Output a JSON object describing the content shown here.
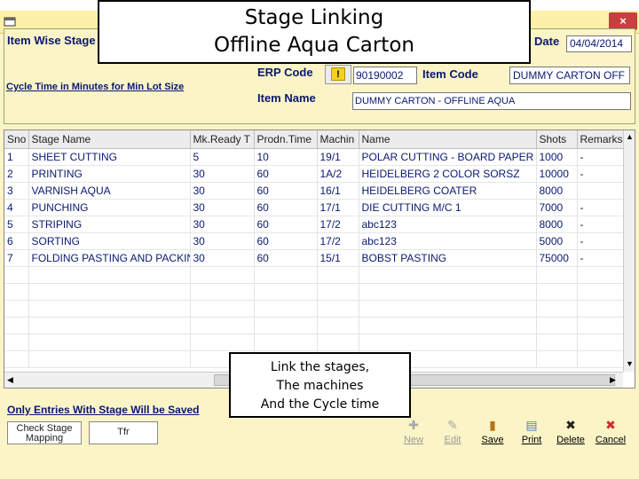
{
  "window": {
    "close_glyph": "×",
    "app_icon": "form-icon",
    "close_color": "#c73f3f"
  },
  "header": {
    "form_title": "Item Wise Stage",
    "date_label": "Date",
    "date_value": "04/04/2014",
    "cycle_time_label": "Cycle Time in Minutes for Min Lot Size",
    "erp_code_label": "ERP Code",
    "warn_glyph": "!",
    "erp_code_value": "90190002",
    "item_code_label": "Item Code",
    "item_code_value": "DUMMY CARTON   OFF",
    "item_name_label": "Item Name",
    "item_name_value": "DUMMY CARTON - OFFLINE AQUA"
  },
  "grid": {
    "columns": [
      "Sno",
      "Stage Name",
      "Mk.Ready T",
      "Prodn.Time",
      "Machin",
      "Name",
      "Shots",
      "Remarks"
    ],
    "rows": [
      [
        "1",
        "SHEET CUTTING",
        "5",
        "10",
        "19/1",
        "POLAR CUTTING - BOARD PAPER",
        "1000",
        "-"
      ],
      [
        "2",
        "PRINTING",
        "30",
        "60",
        "1A/2",
        "HEIDELBERG 2 COLOR SORSZ",
        "10000",
        "-"
      ],
      [
        "3",
        "VARNISH   AQUA",
        "30",
        "60",
        "16/1",
        "HEIDELBERG COATER",
        "8000",
        ""
      ],
      [
        "4",
        "PUNCHING",
        "30",
        "60",
        "17/1",
        "DIE CUTTING M/C 1",
        "7000",
        "-"
      ],
      [
        "5",
        "STRIPING",
        "30",
        "60",
        "17/2",
        "abc123",
        "8000",
        "-"
      ],
      [
        "6",
        "SORTING",
        "30",
        "60",
        "17/2",
        "abc123",
        "5000",
        "-"
      ],
      [
        "7",
        "FOLDING PASTING AND PACKING",
        "30",
        "60",
        "15/1",
        "BOBST PASTING",
        "75000",
        "-"
      ]
    ],
    "empty_rows": 6
  },
  "footer": {
    "note": "Only Entries With Stage Will be Saved",
    "check_button": [
      "Check Stage",
      "Mapping"
    ],
    "tfr_button": "Tfr"
  },
  "toolbar": {
    "buttons": [
      {
        "label": "New",
        "icon": "new-icon",
        "glyph": "✚",
        "enabled": false
      },
      {
        "label": "Edit",
        "icon": "edit-icon",
        "glyph": "✎",
        "enabled": false
      },
      {
        "label": "Save",
        "icon": "save-icon",
        "glyph": "▮",
        "enabled": true
      },
      {
        "label": "Print",
        "icon": "print-icon",
        "glyph": "▤",
        "enabled": true
      },
      {
        "label": "Delete",
        "icon": "delete-icon",
        "glyph": "✖",
        "enabled": true
      },
      {
        "label": "Cancel",
        "icon": "cancel-icon",
        "glyph": "✖",
        "enabled": true
      }
    ]
  },
  "callouts": {
    "top": [
      "Stage Linking",
      "Offline Aqua Carton"
    ],
    "middle": [
      "Link the stages,",
      "The machines",
      "And the Cycle time"
    ]
  },
  "colors": {
    "window_bg": "#fbf4c6",
    "label_text": "#0a1970",
    "save_icon": "#b2761a",
    "print_icon": "#5a7fb5",
    "cancel_icon": "#d22b2b"
  }
}
